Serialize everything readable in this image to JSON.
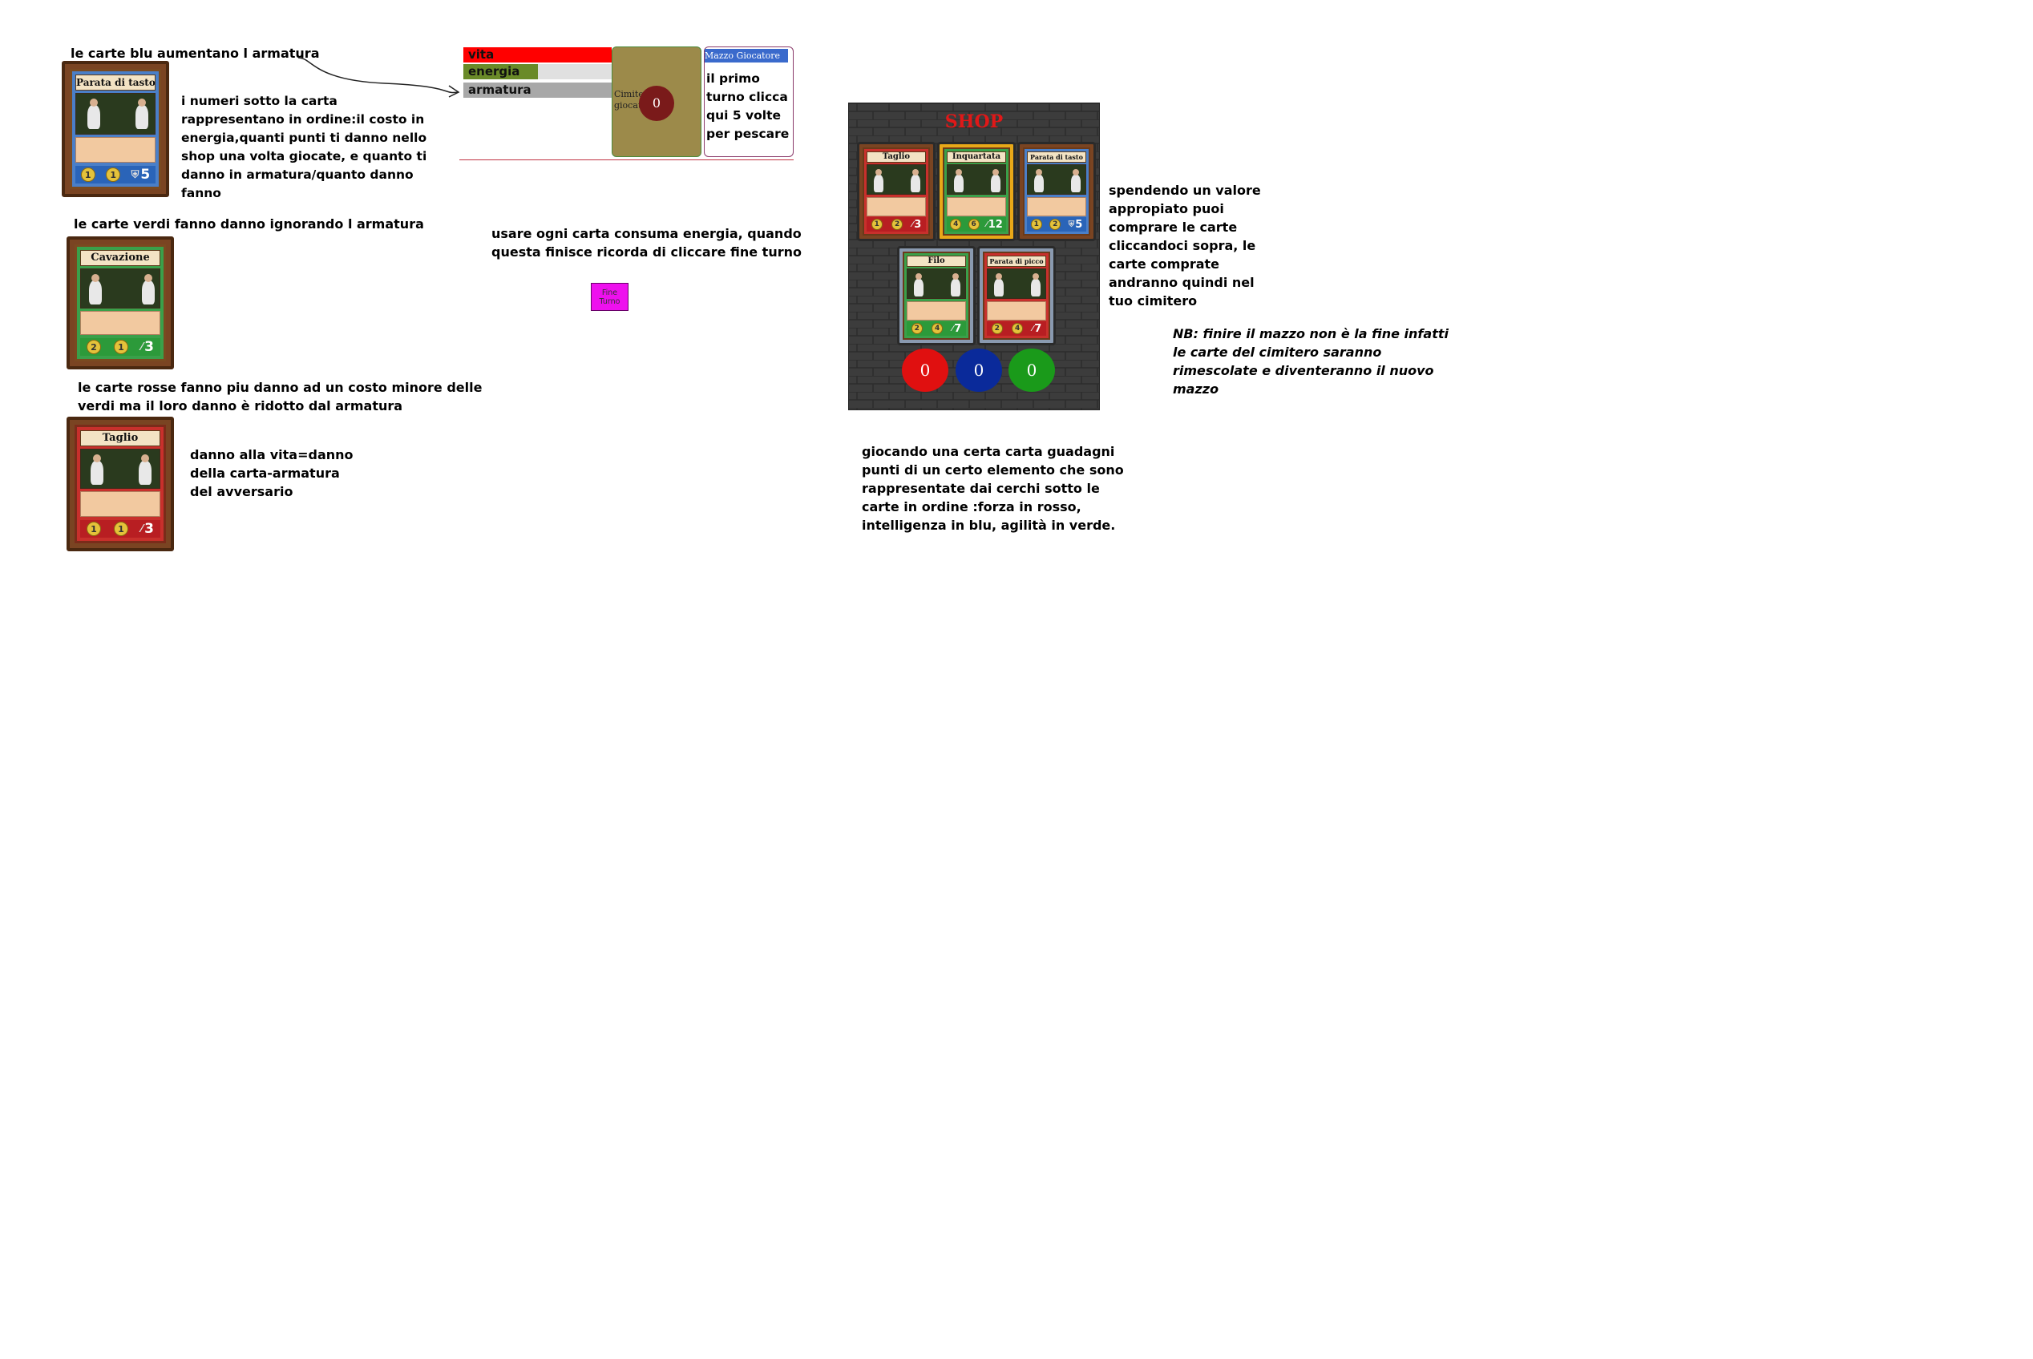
{
  "notes": {
    "blue_cards": "le carte blu aumentano l armatura",
    "numbers_explain": "i numeri sotto la carta\nrappresentano in ordine:il costo in\nenergia,quanti punti ti danno nello\nshop una volta giocate, e quanto ti\ndanno in armatura/quanto danno\nfanno",
    "green_cards": "le carte verdi fanno danno ignorando l armatura",
    "red_cards": "le carte rosse fanno piu danno ad un costo minore delle\nverdi ma il loro danno è ridotto dal armatura",
    "damage_explain": "danno alla vita=danno\ndella carta-armatura\ndel avversario",
    "energy_explain": "usare ogni carta consuma energia, quando\nquesta finisce ricorda di cliccare fine turno",
    "first_turn": "il primo\nturno clicca\nqui 5 volte\nper pescare",
    "shop_explain": "spendendo un valore\nappropiato puoi\ncomprare le carte\ncliccandoci sopra, le\ncarte comprate\nandranno quindi nel\ntuo cimitero",
    "nb": "NB: finire il mazzo non è la fine infatti\nle carte del cimitero saranno\nrimescolate e diventeranno il nuovo\nmazzo",
    "points_explain": "giocando una certa carta guadagni\npunti di un certo elemento che sono\nrappresentate  dai cerchi  sotto le\ncarte in ordine :forza in rosso,\nintelligenza in blu, agilità in verde."
  },
  "status": {
    "vita_label": "vita",
    "energia_label": "energia",
    "armatura_label": "armatura",
    "vita_fill": 1.0,
    "energia_fill": 0.5,
    "armatura_fill": 1.0,
    "cimitero_label": "Cimitero\ngiocatore",
    "cimitero_count": "0",
    "mazzo_label": "Mazzo Giocatore"
  },
  "end_turn": {
    "label": "Fine\nTurno"
  },
  "examples": [
    {
      "title": "Parata di tasto",
      "cost": "1",
      "points": "1",
      "value": "5",
      "color": "blue"
    },
    {
      "title": "Cavazione",
      "cost": "2",
      "points": "1",
      "value": "3",
      "color": "green"
    },
    {
      "title": "Taglio",
      "cost": "1",
      "points": "1",
      "value": "3",
      "color": "red"
    }
  ],
  "shop": {
    "title": "SHOP",
    "cards": [
      {
        "title": "Taglio",
        "cost": "1",
        "points": "2",
        "value": "3",
        "color": "red"
      },
      {
        "title": "Inquartata",
        "cost": "4",
        "points": "6",
        "value": "12",
        "color": "green"
      },
      {
        "title": "Parata di tasto",
        "cost": "1",
        "points": "2",
        "value": "5",
        "color": "blue"
      },
      {
        "title": "Filo",
        "cost": "2",
        "points": "4",
        "value": "7",
        "color": "green"
      },
      {
        "title": "Parata di picco",
        "cost": "2",
        "points": "4",
        "value": "7",
        "color": "red"
      }
    ],
    "points": {
      "forza": "0",
      "intelligenza": "0",
      "agilita": "0"
    },
    "colors": {
      "forza": "#e01010",
      "intelligenza": "#0a2a9a",
      "agilita": "#1a9a1a"
    }
  }
}
